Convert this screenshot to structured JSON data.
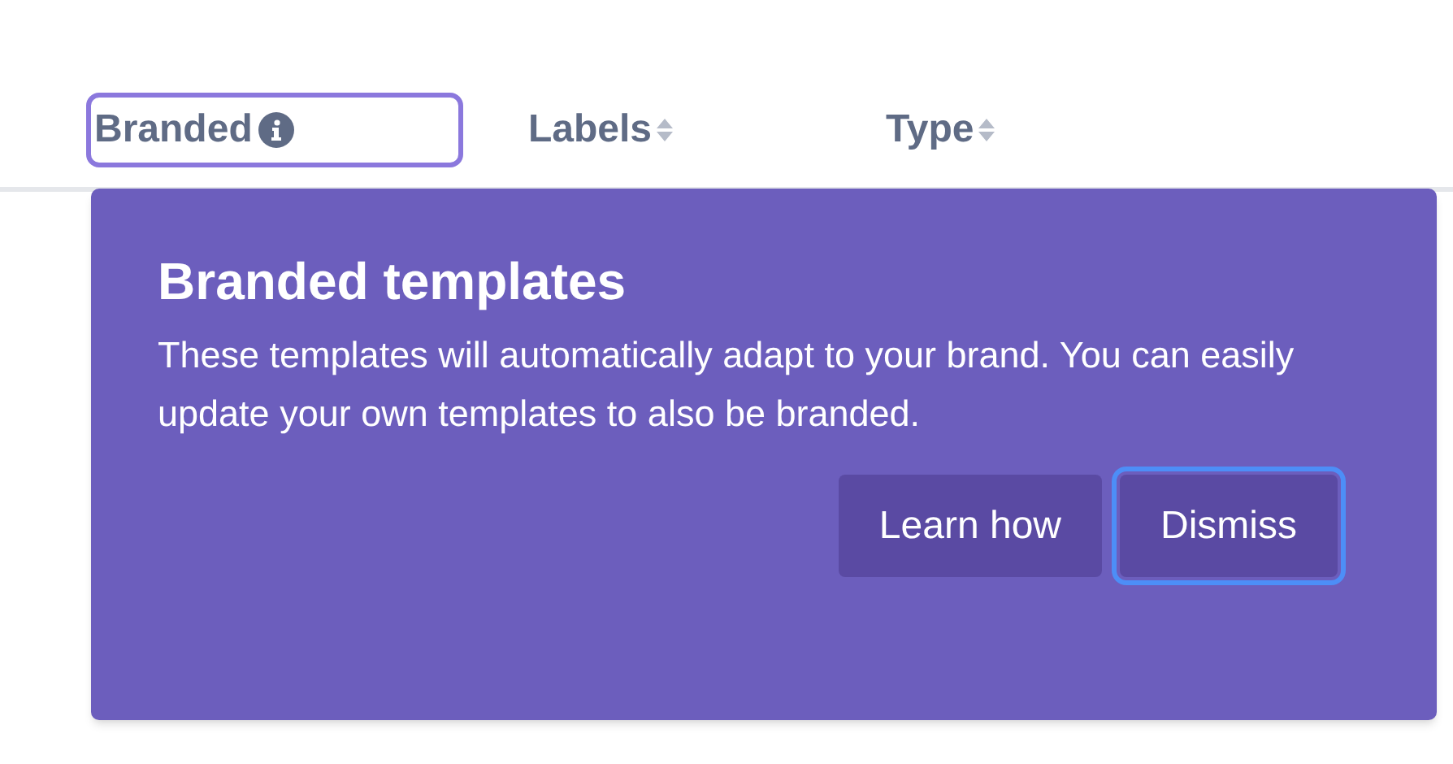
{
  "columns": [
    {
      "label": "Branded",
      "kind": "info",
      "focused": true
    },
    {
      "label": "Labels",
      "kind": "sortable",
      "focused": false
    },
    {
      "label": "Type",
      "kind": "sortable",
      "focused": false
    }
  ],
  "popover": {
    "title": "Branded templates",
    "body": "These templates will automatically adapt to your brand. You can easily update your own templates to also be branded.",
    "buttons": [
      {
        "label": "Learn how",
        "focused": false
      },
      {
        "label": "Dismiss",
        "focused": true
      }
    ]
  }
}
